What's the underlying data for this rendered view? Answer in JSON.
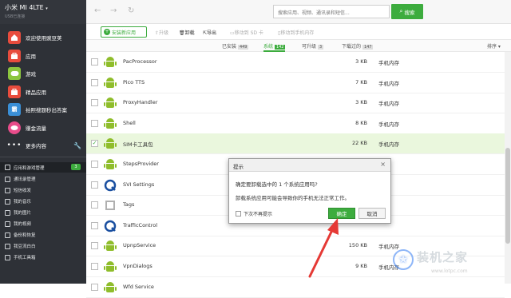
{
  "device": {
    "name": "小米 MI 4LTE",
    "sub": "USB已连接"
  },
  "sidebar": {
    "items": [
      {
        "label": "欢迎使用豌豆荚",
        "icon": "home-icon",
        "color": "#e84c3d"
      },
      {
        "label": "应用",
        "icon": "bag-icon",
        "color": "#e84c3d"
      },
      {
        "label": "游戏",
        "icon": "gamepad-icon",
        "color": "#8cc63f"
      },
      {
        "label": "精品应用",
        "icon": "bag-icon",
        "color": "#e84c3d"
      },
      {
        "label": "拍照搜题秒出答案",
        "icon": "ba-icon",
        "color": "#3a8fd6"
      },
      {
        "label": "赚金流量",
        "icon": "chat-icon",
        "color": "#e84c8a"
      }
    ],
    "more_label": "更多内容",
    "secondary": [
      {
        "label": "应用和游戏管理",
        "badge": "3",
        "active": true
      },
      {
        "label": "通讯录管理"
      },
      {
        "label": "短信收发"
      },
      {
        "label": "我的音乐"
      },
      {
        "label": "我的图片"
      },
      {
        "label": "我的视频"
      },
      {
        "label": "备份和恢复"
      },
      {
        "label": "我豆流白白"
      },
      {
        "label": "手机工具箱"
      }
    ]
  },
  "search": {
    "placeholder": "搜索应用、视频、通讯录和短信...",
    "button": "搜索"
  },
  "toolbar": {
    "install": "安装新应用",
    "upgrade": "升级",
    "uninstall": "卸载",
    "export": "导出",
    "move_sd": "移动到 SD 卡",
    "move_phone": "移动到手机内存"
  },
  "filter": {
    "tabs": [
      {
        "label": "已安装",
        "count": "449"
      },
      {
        "label": "系统",
        "count": "142",
        "active": true
      },
      {
        "label": "可升级",
        "count": "3"
      },
      {
        "label": "下载过的",
        "count": "147"
      }
    ],
    "sort": "排序"
  },
  "apps": [
    {
      "name": "PacProcessor",
      "size": "3 KB",
      "location": "手机内存",
      "icon": "android",
      "checked": false
    },
    {
      "name": "Pico TTS",
      "size": "7 KB",
      "location": "手机内存",
      "icon": "android",
      "checked": false
    },
    {
      "name": "ProxyHandler",
      "size": "3 KB",
      "location": "手机内存",
      "icon": "android",
      "checked": false
    },
    {
      "name": "Shell",
      "size": "8 KB",
      "location": "手机内存",
      "icon": "android",
      "checked": false
    },
    {
      "name": "SIM卡工具包",
      "size": "22 KB",
      "location": "手机内存",
      "icon": "android",
      "checked": true
    },
    {
      "name": "StepsProvider",
      "size": "",
      "location": "",
      "icon": "puzzle",
      "checked": false
    },
    {
      "name": "SVI Settings",
      "size": "",
      "location": "",
      "icon": "q",
      "checked": false
    },
    {
      "name": "Tags",
      "size": "",
      "location": "",
      "icon": "tag",
      "checked": false
    },
    {
      "name": "TrafficControl",
      "size": "",
      "location": "",
      "icon": "q",
      "checked": false
    },
    {
      "name": "UpnpService",
      "size": "150 KB",
      "location": "手机内存",
      "icon": "android",
      "checked": false
    },
    {
      "name": "VpnDialogs",
      "size": "9 KB",
      "location": "手机内存",
      "icon": "android",
      "checked": false
    },
    {
      "name": "Wfd Service",
      "size": "",
      "location": "",
      "icon": "android",
      "checked": false
    }
  ],
  "dialog": {
    "title": "提示",
    "line1": "确定要卸载选中的 1 个系统应用吗?",
    "line2": "卸载系统应用可能会导致你的手机无法正常工作。",
    "dont_ask": "下次不再提示",
    "ok": "确定",
    "cancel": "取消"
  },
  "watermark": {
    "brand": "装机之家",
    "url": "www.lotpc.com"
  },
  "colors": {
    "accent": "#3dac3e",
    "sidebar": "#2e3137",
    "selected_row": "#eaf7dd",
    "arrow": "#e53935"
  }
}
